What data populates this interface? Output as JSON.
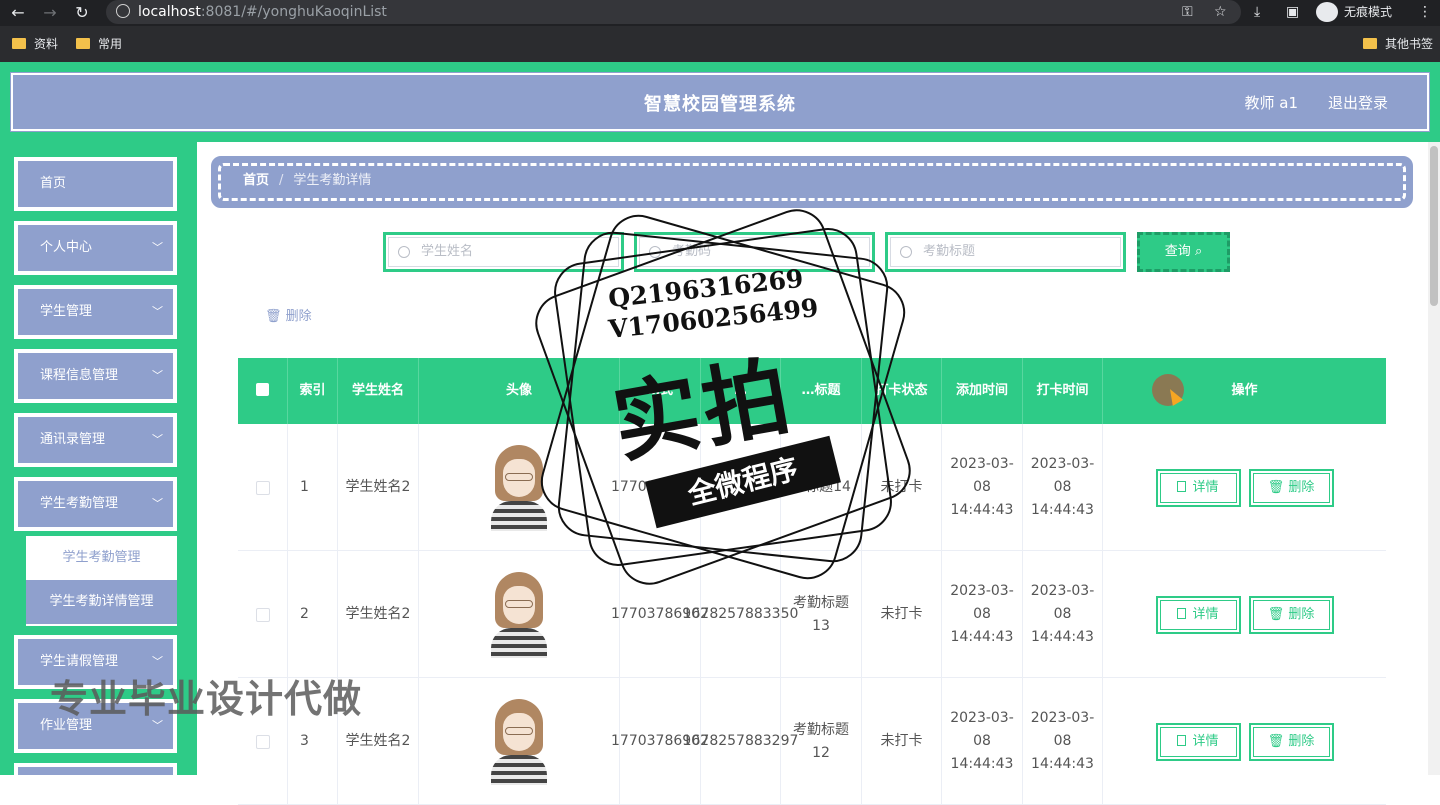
{
  "browser": {
    "url_host": "localhost",
    "url_path": ":8081/#/yonghuKaoqinList",
    "incognito_label": "无痕模式",
    "bookmarks": [
      "资料",
      "常用"
    ],
    "other_bookmarks": "其他书签"
  },
  "header": {
    "title": "智慧校园管理系统",
    "user": "教师 a1",
    "logout": "退出登录"
  },
  "sidebar": {
    "items": [
      {
        "label": "首页",
        "chevron": false
      },
      {
        "label": "个人中心",
        "chevron": true
      },
      {
        "label": "学生管理",
        "chevron": true
      },
      {
        "label": "课程信息管理",
        "chevron": true
      },
      {
        "label": "通讯录管理",
        "chevron": true
      },
      {
        "label": "学生考勤管理",
        "chevron": true
      },
      {
        "label": "学生请假管理",
        "chevron": true
      },
      {
        "label": "作业管理",
        "chevron": true
      }
    ],
    "submenu": [
      "学生考勤管理",
      "学生考勤详情管理"
    ]
  },
  "breadcrumb": {
    "home": "首页",
    "sep": "/",
    "current": "学生考勤详情"
  },
  "search": {
    "name_placeholder": "学生姓名",
    "code_placeholder": "考勤码",
    "title_placeholder": "考勤标题",
    "query_label": "查询"
  },
  "toolbar": {
    "delete_label": "删除"
  },
  "table": {
    "headers": [
      "",
      "索引",
      "学生姓名",
      "头像",
      "…式",
      "…",
      "…标题",
      "打卡状态",
      "添加时间",
      "打卡时间",
      "操作"
    ],
    "rows": [
      {
        "index": "1",
        "name": "学生姓名2",
        "phone": "17703786902",
        "code": "",
        "title": "…标题14",
        "status": "未打卡",
        "add_time": "2023-03-08 14:44:43",
        "punch_time": "2023-03-08 14:44:43"
      },
      {
        "index": "2",
        "name": "学生姓名2",
        "phone": "17703786902",
        "code": "1678257883350",
        "title": "考勤标题13",
        "status": "未打卡",
        "add_time": "2023-03-08 14:44:43",
        "punch_time": "2023-03-08 14:44:43"
      },
      {
        "index": "3",
        "name": "学生姓名2",
        "phone": "17703786902",
        "code": "1678257883297",
        "title": "考勤标题12",
        "status": "未打卡",
        "add_time": "2023-03-08 14:44:43",
        "punch_time": "2023-03-08 14:44:43"
      }
    ],
    "detail_label": "详情",
    "delete_label": "删除"
  },
  "overlay": {
    "line1": "Q2196316269",
    "line2": "V17060256499",
    "big": "实拍",
    "banner": "全微程序",
    "watermark": "专业毕业设计代做"
  },
  "colors": {
    "green": "#2ecb87",
    "lavender": "#8fa0cd"
  }
}
